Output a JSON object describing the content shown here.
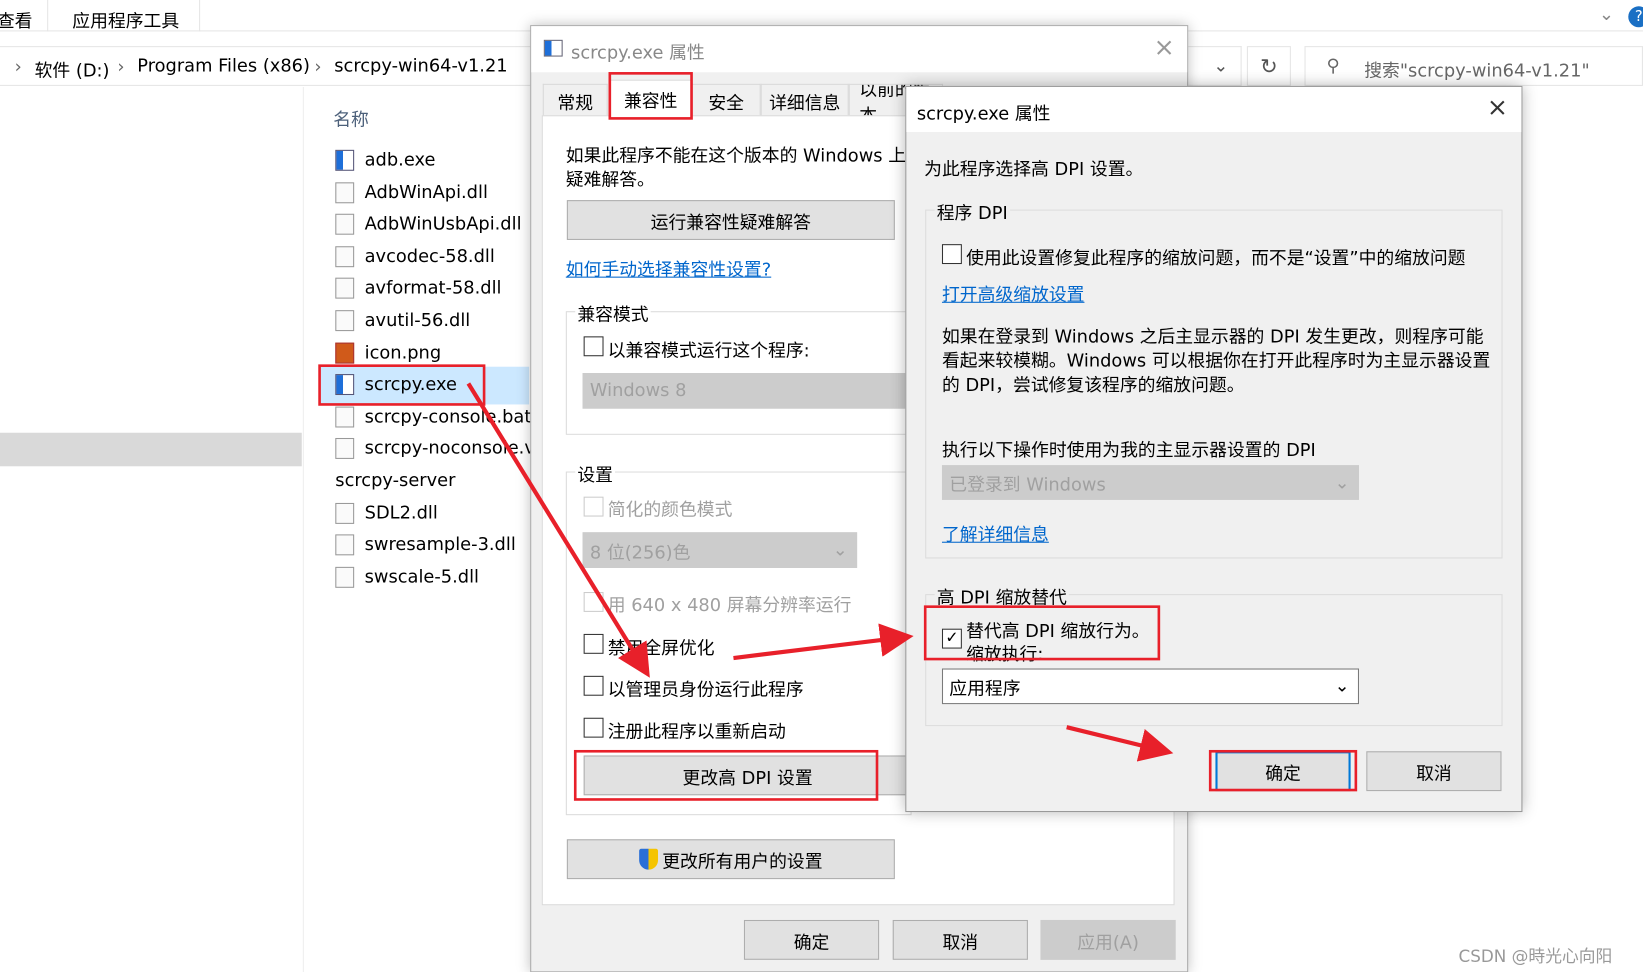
{
  "explorer": {
    "ribbon_tabs": [
      "查看",
      "应用程序工具"
    ],
    "breadcrumb": [
      "软件 (D:)",
      "Program Files (x86)",
      "scrcpy-win64-v1.21"
    ],
    "search_placeholder": "搜索\"scrcpy-win64-v1.21\"",
    "column_name": "名称",
    "files": [
      {
        "name": "adb.exe",
        "type": "exe"
      },
      {
        "name": "AdbWinApi.dll",
        "type": "dll"
      },
      {
        "name": "AdbWinUsbApi.dll",
        "type": "dll"
      },
      {
        "name": "avcodec-58.dll",
        "type": "dll"
      },
      {
        "name": "avformat-58.dll",
        "type": "dll"
      },
      {
        "name": "avutil-56.dll",
        "type": "dll"
      },
      {
        "name": "icon.png",
        "type": "png"
      },
      {
        "name": "scrcpy.exe",
        "type": "exe",
        "selected": true
      },
      {
        "name": "scrcpy-console.bat",
        "type": "dll"
      },
      {
        "name": "scrcpy-noconsole.vbs",
        "type": "dll"
      },
      {
        "name": "scrcpy-server",
        "type": "file"
      },
      {
        "name": "SDL2.dll",
        "type": "dll"
      },
      {
        "name": "swresample-3.dll",
        "type": "dll"
      },
      {
        "name": "swscale-5.dll",
        "type": "dll"
      }
    ]
  },
  "props_dialog": {
    "title": "scrcpy.exe 属性",
    "tabs": [
      "常规",
      "兼容性",
      "安全",
      "详细信息",
      "以前的版本"
    ],
    "active_tab": "兼容性",
    "intro": "如果此程序不能在这个版本的 Windows 上",
    "intro2": "疑难解答。",
    "troubleshoot_button": "运行兼容性疑难解答",
    "manual_link": "如何手动选择兼容性设置?",
    "compat_group": "兼容模式",
    "compat_checkbox": "以兼容模式运行这个程序:",
    "compat_select": "Windows 8",
    "settings_group": "设置",
    "reduced_color": "简化的颜色模式",
    "color_select": "8 位(256)色",
    "res_640": "用 640 x 480 屏幕分辨率运行",
    "disable_fullscreen": "禁用全屏优化",
    "run_as_admin": "以管理员身份运行此程序",
    "register_restart": "注册此程序以重新启动",
    "dpi_button": "更改高 DPI 设置",
    "all_users_button": "更改所有用户的设置",
    "ok": "确定",
    "cancel": "取消",
    "apply": "应用(A)"
  },
  "dpi_dialog": {
    "title": "scrcpy.exe 属性",
    "intro": "为此程序选择高 DPI 设置。",
    "program_dpi_group": "程序 DPI",
    "fix_scaling_checkbox": "使用此设置修复此程序的缩放问题，而不是“设置”中的缩放问题",
    "advanced_link": "打开高级缩放设置",
    "desc1": "如果在登录到 Windows 之后主显示器的 DPI 发生更改，则程序可能",
    "desc2": "看起来较模糊。Windows 可以根据你在打开此程序时为主显示器设置",
    "desc3": "的 DPI，尝试修复该程序的缩放问题。",
    "use_dpi_label": "执行以下操作时使用为我的主显示器设置的 DPI",
    "use_dpi_select": "已登录到 Windows",
    "learn_more_link": "了解详细信息",
    "override_group": "高 DPI 缩放替代",
    "override_checkbox": "替代高 DPI 缩放行为。",
    "override_checked": true,
    "scaling_by": "缩放执行:",
    "scaling_select": "应用程序",
    "ok": "确定",
    "cancel": "取消"
  },
  "annotation_color": "#e8202a",
  "watermark": "CSDN @時光心向阳"
}
